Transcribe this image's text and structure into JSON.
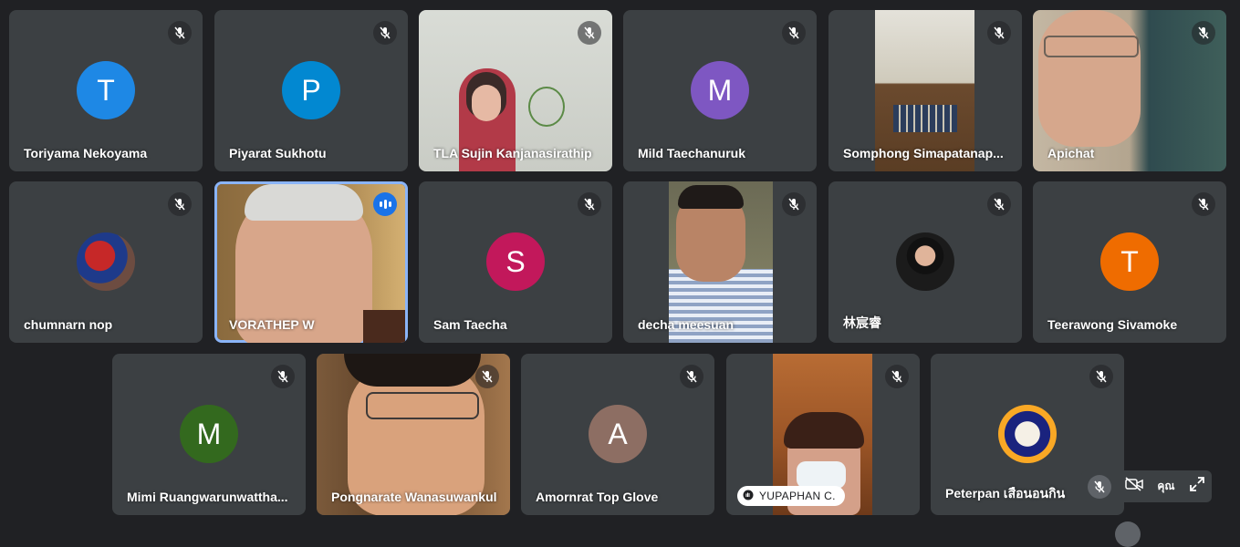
{
  "participants": [
    {
      "name": "Toriyama Nekoyama",
      "initial": "T",
      "color": "#1e88e5"
    },
    {
      "name": "Piyarat Sukhotu",
      "initial": "P",
      "color": "#0288d1"
    },
    {
      "name": "TLA Sujin Kanjanasirathip"
    },
    {
      "name": "Mild Taechanuruk",
      "initial": "M",
      "color": "#7e57c2"
    },
    {
      "name": "Somphong Simapatanap..."
    },
    {
      "name": "Apichat"
    },
    {
      "name": "chumnarn nop"
    },
    {
      "name": "VORATHEP W"
    },
    {
      "name": "Sam Taecha",
      "initial": "S",
      "color": "#c2185b"
    },
    {
      "name": "decha meesuan"
    },
    {
      "name": "林宸睿"
    },
    {
      "name": "Teerawong Sivamoke",
      "initial": "T",
      "color": "#ef6c00"
    },
    {
      "name": "Mimi Ruangwarunwattha...",
      "initial": "M",
      "color": "#33691e"
    },
    {
      "name": "Pongnarate Wanasuwankul"
    },
    {
      "name": "Amornrat Top Glove",
      "initial": "A",
      "color": "#8d6e63"
    },
    {
      "name": "YUPAPHAN C."
    },
    {
      "name": "Peterpan เสือนอนกิน"
    }
  ],
  "self_view": {
    "label": "คุณ"
  },
  "icons": {
    "muted": "mic-off-icon",
    "speaking": "audio-level-icon",
    "camera_off": "camera-off-icon",
    "expand": "expand-icon",
    "presenting": "hand-icon"
  },
  "colors": {
    "background": "#202124",
    "tile": "#3c4043",
    "active_border": "#8ab4f8"
  }
}
